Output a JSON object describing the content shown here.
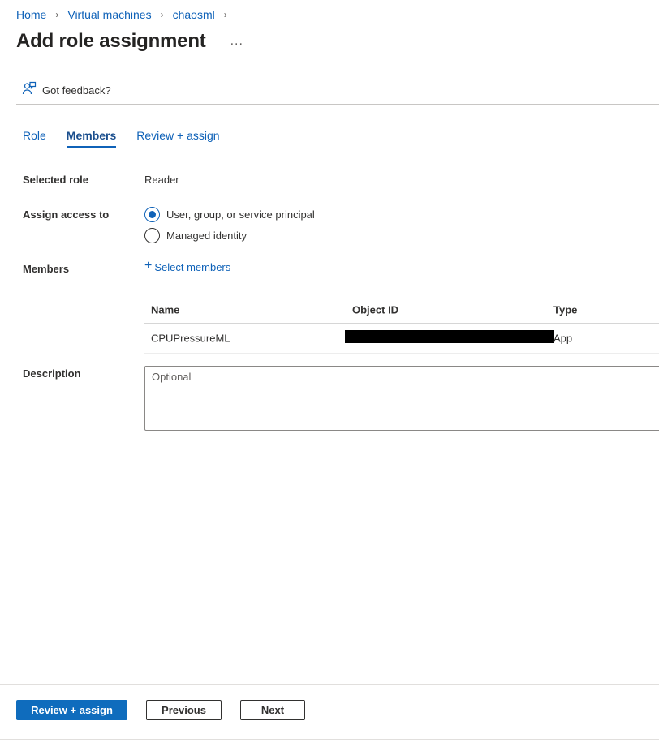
{
  "breadcrumb": [
    {
      "label": "Home"
    },
    {
      "label": "Virtual machines"
    },
    {
      "label": "chaosml"
    }
  ],
  "header": {
    "title": "Add role assignment",
    "more_label": "..."
  },
  "feedback": {
    "label": "Got feedback?"
  },
  "tabs": [
    {
      "label": "Role",
      "active": false
    },
    {
      "label": "Members",
      "active": true
    },
    {
      "label": "Review + assign",
      "active": false
    }
  ],
  "form": {
    "selected_role_label": "Selected role",
    "selected_role_value": "Reader",
    "assign_access_label": "Assign access to",
    "assign_options": [
      {
        "label": "User, group, or service principal",
        "checked": true
      },
      {
        "label": "Managed identity",
        "checked": false
      }
    ],
    "members_label": "Members",
    "select_members_label": "Select members",
    "description_label": "Description",
    "description_placeholder": "Optional",
    "description_value": ""
  },
  "members_table": {
    "columns": [
      "Name",
      "Object ID",
      "Type"
    ],
    "rows": [
      {
        "name": "CPUPressureML",
        "object_id_redacted": true,
        "type": "App"
      }
    ]
  },
  "footer": {
    "review_assign_label": "Review + assign",
    "previous_label": "Previous",
    "next_label": "Next"
  },
  "colors": {
    "link": "#0f62b8",
    "primary_button": "#0f6cbd",
    "text": "#323130"
  }
}
